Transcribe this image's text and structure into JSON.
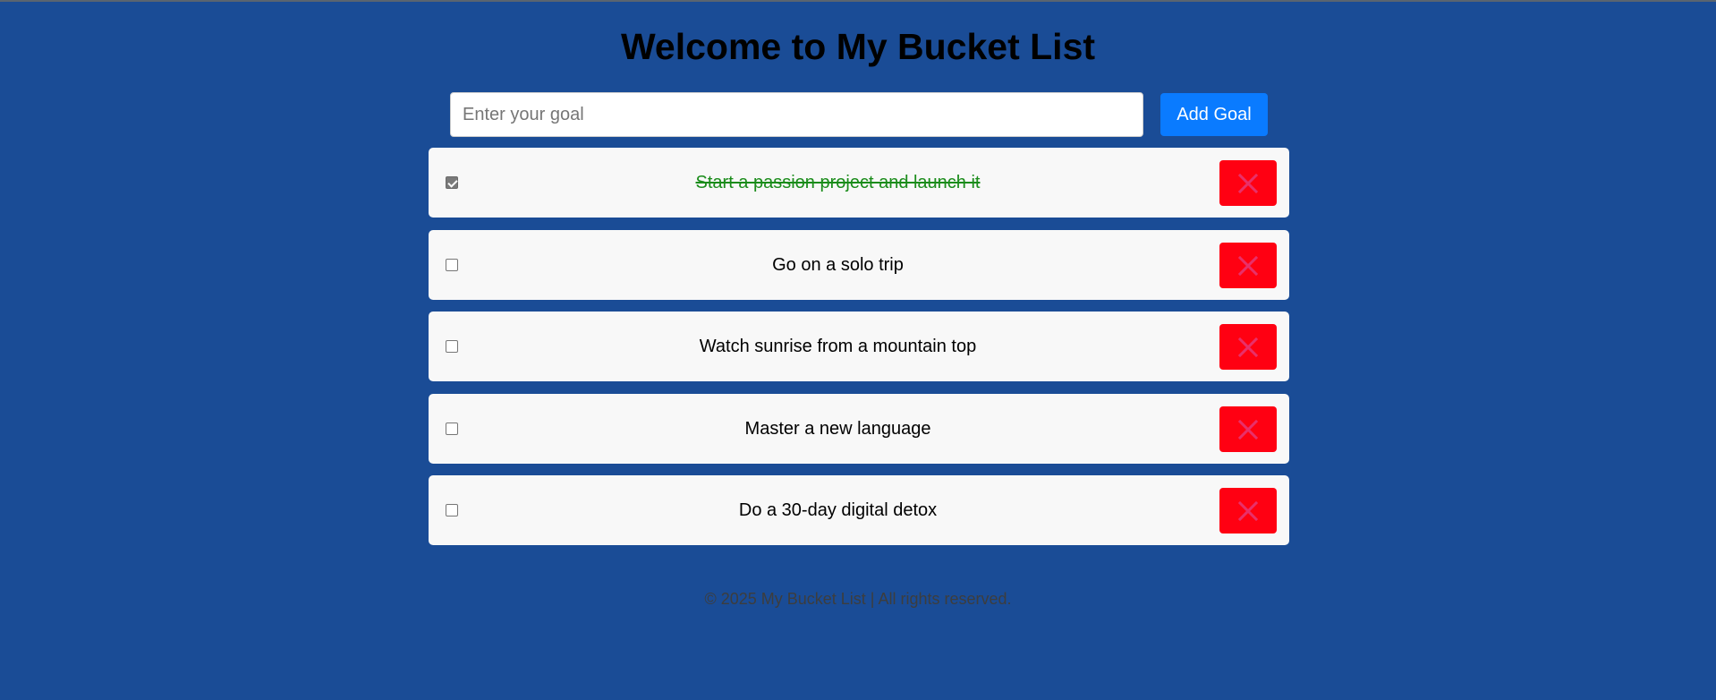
{
  "header": {
    "title": "Welcome to My Bucket List"
  },
  "form": {
    "placeholder": "Enter your goal",
    "add_label": "Add Goal"
  },
  "goals": [
    {
      "text": "Start a passion project and launch it",
      "completed": true
    },
    {
      "text": "Go on a solo trip",
      "completed": false
    },
    {
      "text": "Watch sunrise from a mountain top",
      "completed": false
    },
    {
      "text": "Master a new language",
      "completed": false
    },
    {
      "text": "Do a 30-day digital detox",
      "completed": false
    }
  ],
  "icons": {
    "delete": "close-icon"
  },
  "colors": {
    "background": "#1a4c96",
    "add_button": "#0a7bff",
    "delete_button": "#ff0012",
    "delete_icon": "#e8306a",
    "completed_text": "#1a8c1a"
  },
  "footer": {
    "text": "© 2025 My Bucket List | All rights reserved."
  }
}
